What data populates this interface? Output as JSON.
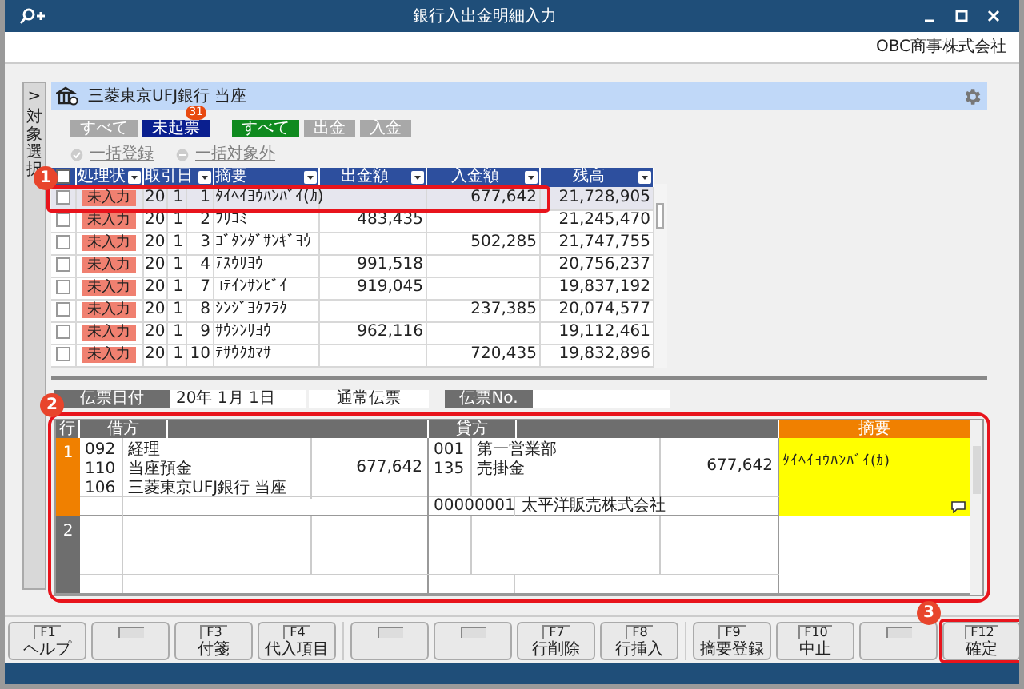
{
  "window": {
    "title": "銀行入出金明細入力"
  },
  "company": "OBC商事株式会社",
  "side_tab": {
    "arrow": ">",
    "label": "対象選択"
  },
  "account": {
    "name": "三菱東京UFJ銀行 当座"
  },
  "filter_groups": [
    [
      {
        "label": "すべて",
        "selected": false
      },
      {
        "label": "未起票",
        "selected": true,
        "badge": "31"
      }
    ],
    [
      {
        "label": "すべて",
        "selected": true
      },
      {
        "label": "出金",
        "selected": false
      },
      {
        "label": "入金",
        "selected": false
      }
    ]
  ],
  "bulk_actions": [
    {
      "label": "一括登録",
      "kind": "check"
    },
    {
      "label": "一括対象外",
      "kind": "minus"
    }
  ],
  "table": {
    "all_checked": false,
    "columns": [
      "処理状",
      "取引日",
      "摘要",
      "出金額",
      "入金額",
      "残高"
    ],
    "rows": [
      {
        "selected": true,
        "checked": false,
        "status": "未入力",
        "year": "20",
        "month": "1",
        "day": "1",
        "description": "ﾀｲﾍｲﾖｳﾊﾝﾊﾞｲ(ｶ)",
        "deposit": "677,642",
        "balance": "21,728,905"
      },
      {
        "selected": false,
        "checked": false,
        "status": "未入力",
        "year": "20",
        "month": "1",
        "day": "2",
        "description": "ﾌﾘｺﾐ",
        "withdrawal": "483,435",
        "balance": "21,245,470"
      },
      {
        "selected": false,
        "checked": false,
        "status": "未入力",
        "year": "20",
        "month": "1",
        "day": "3",
        "description": "ｺﾞﾀﾝﾀﾞｻﾝｷﾞﾖｳ",
        "deposit": "502,285",
        "balance": "21,747,755"
      },
      {
        "selected": false,
        "checked": false,
        "status": "未入力",
        "year": "20",
        "month": "1",
        "day": "4",
        "description": "ﾃｽｳﾘﾖｳ",
        "withdrawal": "991,518",
        "balance": "20,756,237"
      },
      {
        "selected": false,
        "checked": false,
        "status": "未入力",
        "year": "20",
        "month": "1",
        "day": "7",
        "description": "ｺﾃｲﾝｻﾝﾋﾞｲ",
        "withdrawal": "919,045",
        "balance": "19,837,192"
      },
      {
        "selected": false,
        "checked": false,
        "status": "未入力",
        "year": "20",
        "month": "1",
        "day": "8",
        "description": "ｼﾝｼﾞﾖｸﾌﾗｸ",
        "deposit": "237,385",
        "balance": "20,074,577"
      },
      {
        "selected": false,
        "checked": false,
        "status": "未入力",
        "year": "20",
        "month": "1",
        "day": "9",
        "description": "ｻｳｼﾝﾘﾖｳ",
        "withdrawal": "962,116",
        "balance": "19,112,461"
      },
      {
        "selected": false,
        "checked": false,
        "status": "未入力",
        "year": "20",
        "month": "1",
        "day": "10",
        "description": "ﾃｻｳｸｶﾏｻ",
        "deposit": "720,435",
        "balance": "19,832,896"
      }
    ]
  },
  "slip": {
    "date_label": "伝票日付",
    "date": "20年 1月 1日",
    "type": "通常伝票",
    "number_label": "伝票No."
  },
  "journal": {
    "columns": {
      "row": "行",
      "debit": "借方",
      "credit": "貸方",
      "summary": "摘要"
    },
    "entries": [
      {
        "row": "1",
        "selected": true,
        "debit": {
          "lines": [
            {
              "code": "092",
              "name": "経理"
            },
            {
              "code": "110",
              "name": "当座預金"
            },
            {
              "code": "106",
              "name": "三菱東京UFJ銀行 当座"
            }
          ],
          "amount": "677,642"
        },
        "credit": {
          "lines": [
            {
              "code": "001",
              "name": "第一営業部"
            },
            {
              "code": "135",
              "name": "売掛金"
            }
          ],
          "amount": "677,642"
        },
        "partner": {
          "code": "00000001",
          "name": "太平洋販売株式会社"
        },
        "summary": "ﾀｲﾍｲﾖｳﾊﾝﾊﾞｲ(ｶ)"
      },
      {
        "row": "2",
        "selected": false
      }
    ]
  },
  "function_key_groups": [
    [
      {
        "kind": "key",
        "key": "F1",
        "label": "ヘルプ"
      },
      {
        "kind": "blank"
      },
      {
        "kind": "key",
        "key": "F3",
        "label": "付箋"
      },
      {
        "kind": "key",
        "key": "F4",
        "label": "代入項目"
      }
    ],
    [
      {
        "kind": "blank"
      },
      {
        "kind": "blank"
      },
      {
        "kind": "key",
        "key": "F7",
        "label": "行削除"
      },
      {
        "kind": "key",
        "key": "F8",
        "label": "行挿入"
      }
    ],
    [
      {
        "kind": "key",
        "key": "F9",
        "label": "摘要登録"
      },
      {
        "kind": "key",
        "key": "F10",
        "label": "中止"
      },
      {
        "kind": "blank"
      },
      {
        "kind": "key",
        "key": "F12",
        "label": "確定"
      }
    ]
  ],
  "callouts": [
    "1",
    "2",
    "3"
  ]
}
